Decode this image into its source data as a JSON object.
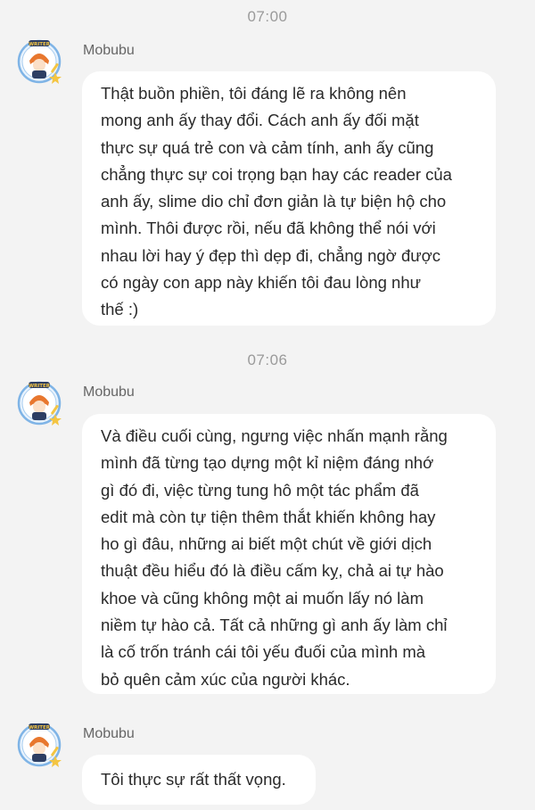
{
  "messages": [
    {
      "time": "07:00",
      "sender": "Mobubu",
      "text": "Thật buồn phiền, tôi đáng lẽ ra không nên\nmong anh ấy thay đổi. Cách anh ấy đối mặt\nthực sự quá trẻ con và cảm tính, anh ấy cũng\nchẳng thực sự coi trọng bạn hay các reader của\nanh ấy, slime dio chỉ đơn giản là tự biện hộ cho\nmình. Thôi được rồi, nếu đã không thể nói với\nnhau lời hay ý đẹp thì dẹp đi, chẳng ngờ được\ncó ngày con app này khiến tôi đau lòng như\nthế :)"
    },
    {
      "time": "07:06",
      "sender": "Mobubu",
      "text": "Và điều cuối cùng, ngưng việc nhấn mạnh rằng\nmình đã từng tạo dựng một kỉ niệm đáng nhớ\ngì đó đi, việc từng tung hô một tác phẩm đã\nedit mà còn tự tiện thêm thắt khiến không hay\nho gì đâu, những ai biết một chút về giới dịch\nthuật đều hiểu đó là điều cấm kỵ, chả ai tự hào\nkhoe và cũng không một ai muốn lấy nó làm\nniềm tự hào cả. Tất cả những gì anh ấy làm chỉ\nlà cố trốn tránh cái tôi yếu đuối của mình mà\nbỏ quên cảm xúc của người khác."
    },
    {
      "sender": "Mobubu",
      "text": "Tôi thực sự rất thất vọng."
    }
  ],
  "avatar": {
    "icon": "avatar-icon",
    "badge_text": "WRITER",
    "ring_color": "#7fb4e6",
    "star_color": "#f4c542",
    "hair_color": "#e8772e"
  }
}
